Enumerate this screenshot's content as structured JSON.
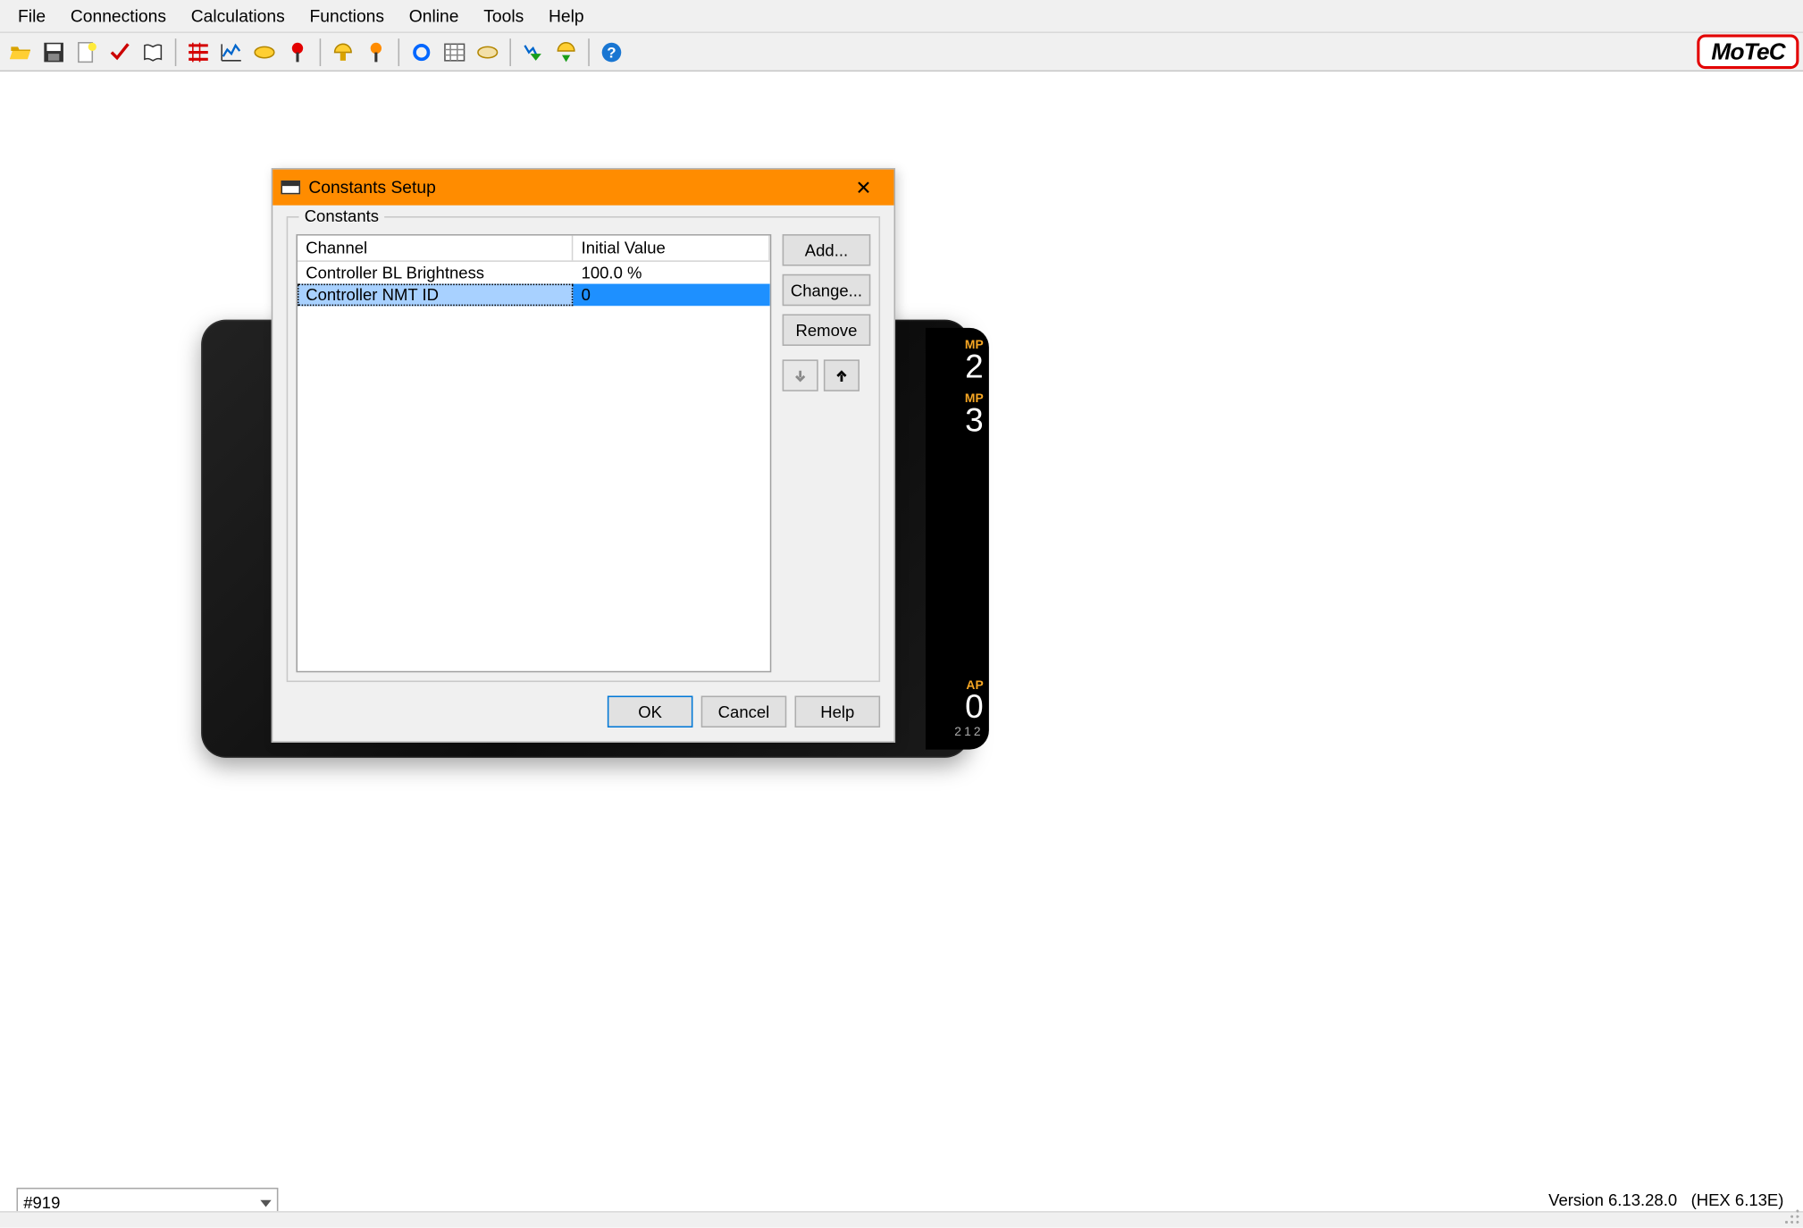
{
  "menu": {
    "items": [
      "File",
      "Connections",
      "Calculations",
      "Functions",
      "Online",
      "Tools",
      "Help"
    ]
  },
  "brand": "MoTeC",
  "toolbar_icons": [
    "open-icon",
    "save-icon",
    "new-page-icon",
    "check-icon",
    "book-icon",
    "sep",
    "bars-red-icon",
    "line-chart-icon",
    "tag-yellow-icon",
    "pin-red-icon",
    "sep",
    "mushroom-yellow-icon",
    "pin-orange-icon",
    "sep",
    "blue-circle-icon",
    "grid-icon",
    "tag-beige-icon",
    "sep",
    "chart-down-green-icon",
    "mushroom-green-icon",
    "sep",
    "help-blue-icon"
  ],
  "dialog": {
    "title": "Constants Setup",
    "group": "Constants",
    "columns": {
      "channel": "Channel",
      "initial": "Initial Value"
    },
    "rows": [
      {
        "channel": "Controller BL Brightness",
        "initial": "100.0 %",
        "selected": false
      },
      {
        "channel": "Controller NMT ID",
        "initial": "0",
        "selected": true
      }
    ],
    "buttons": {
      "add": "Add...",
      "change": "Change...",
      "remove": "Remove",
      "ok": "OK",
      "cancel": "Cancel",
      "help": "Help"
    }
  },
  "device_strip": {
    "top1": {
      "label": "MP",
      "value": "2"
    },
    "top2": {
      "label": "MP",
      "value": "3"
    },
    "lap": {
      "label": "AP",
      "value": "0"
    },
    "model": "212"
  },
  "status": {
    "combo": "#919",
    "version": "Version 6.13.28.0   (HEX 6.13E)"
  }
}
